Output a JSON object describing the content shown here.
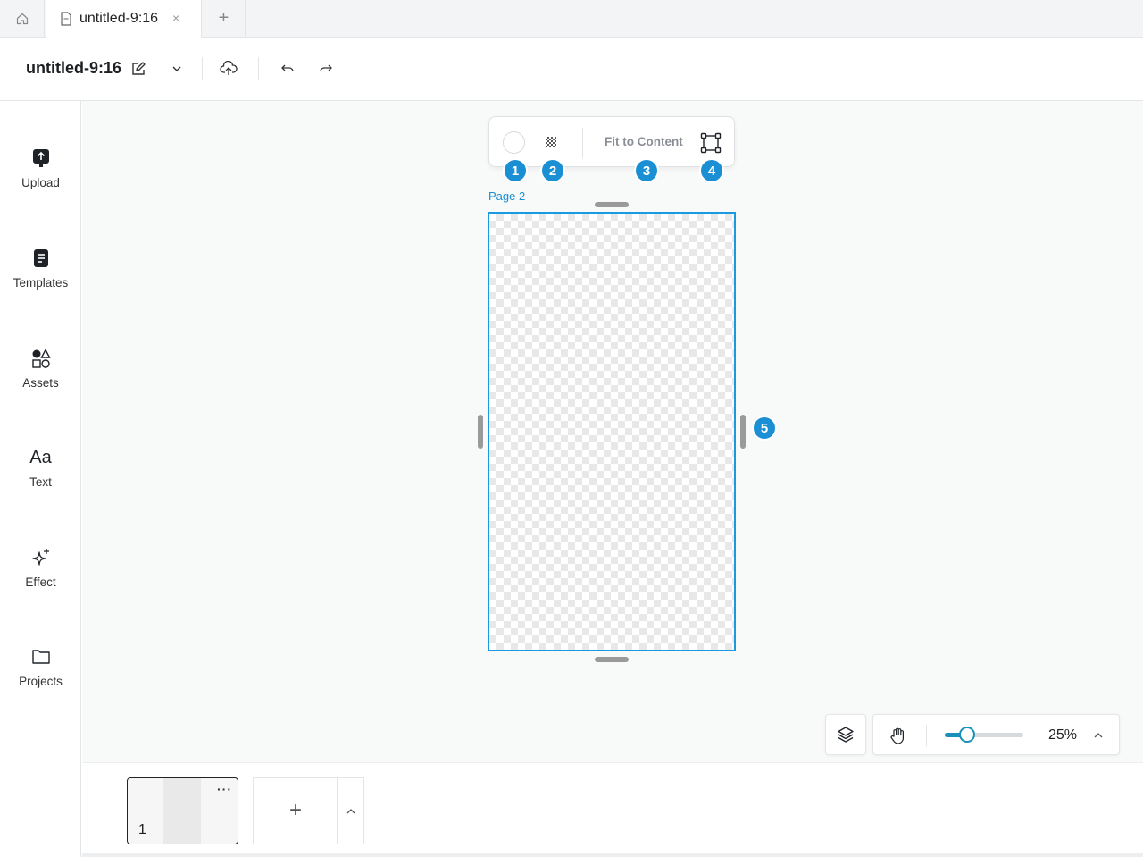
{
  "tabs": {
    "home_icon": "home-icon",
    "active_tab_title": "untitled-9:16",
    "close_glyph": "×",
    "add_glyph": "+"
  },
  "header": {
    "doc_name": "untitled-9:16",
    "icons": [
      "edit-icon",
      "chevron-down-icon",
      "cloud-upload-icon",
      "undo-icon",
      "redo-icon"
    ]
  },
  "sidebar": {
    "items": [
      {
        "label": "Upload",
        "icon": "upload-icon"
      },
      {
        "label": "Templates",
        "icon": "templates-icon"
      },
      {
        "label": "Assets",
        "icon": "shapes-icon"
      },
      {
        "label": "Text",
        "icon": "text-icon"
      },
      {
        "label": "Effect",
        "icon": "sparkle-icon"
      },
      {
        "label": "Projects",
        "icon": "folder-icon"
      }
    ],
    "text_icon_glyph": "Aa"
  },
  "canvas_toolbar": {
    "fit_label": "Fit to Content",
    "badges": [
      "1",
      "2",
      "3",
      "4",
      "5"
    ]
  },
  "page": {
    "label": "Page 2"
  },
  "zoom": {
    "value_label": "25%",
    "level_fraction": 0.28
  },
  "page_strip": {
    "thumb_number": "1",
    "more_glyph": "···",
    "add_glyph": "+"
  },
  "colors": {
    "accent": "#1a8fd4",
    "frame_border": "#1a9ae0",
    "slider": "#1a8fb8"
  }
}
